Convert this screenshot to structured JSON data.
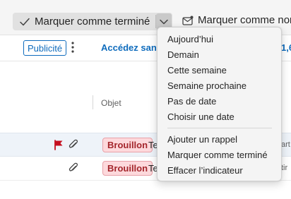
{
  "toolbar": {
    "mark_done_label": "Marquer comme terminé",
    "mark_envelope_label": "Marquer comme non"
  },
  "ad": {
    "badge": "Publicité",
    "link_text": "Accédez san",
    "right_text": "1,6"
  },
  "list_header": {
    "subject_label": "Objet"
  },
  "rows": [
    {
      "draft_badge": "Brouillon",
      "subject": "Te",
      "right": "art",
      "flagged": true,
      "attachment": true
    },
    {
      "draft_badge": "Brouillon",
      "subject": "Te",
      "right": "tir",
      "flagged": false,
      "attachment": true
    }
  ],
  "menu": {
    "items": [
      "Aujourd’hui",
      "Demain",
      "Cette semaine",
      "Semaine prochaine",
      "Pas de date",
      "Choisir une date",
      "Ajouter un rappel",
      "Marquer comme terminé",
      "Effacer l’indicateur"
    ]
  },
  "colors": {
    "accent": "#0f6cbd",
    "flag": "#c50f1f",
    "draft_bg": "#fdd9dc",
    "draft_text": "#a4262c"
  }
}
